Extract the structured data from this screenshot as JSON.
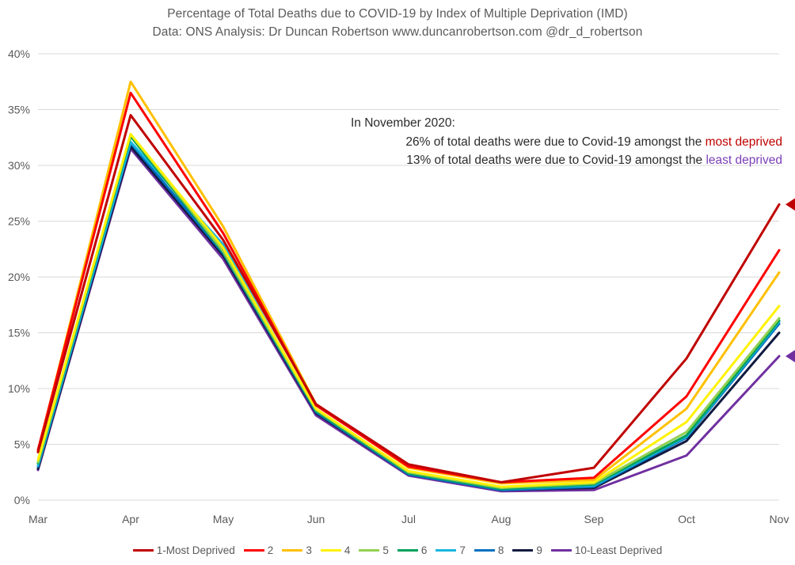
{
  "title": {
    "line1": "Percentage of Total Deaths due to COVID-19 by Index of Multiple Deprivation (IMD)",
    "line2": "Data: ONS Analysis: Dr Duncan Robertson www.duncanrobertson.com @dr_d_robertson"
  },
  "annotation": {
    "line1": "In November 2020:",
    "line2_prefix": "26% of total deaths were due to Covid-19 amongst the ",
    "line2_emphasis": "most deprived",
    "line3_prefix": "13% of total deaths were due to Covid-19 amongst the ",
    "line3_emphasis": "least deprived",
    "most_deprived_color": "#C00000",
    "least_deprived_color": "#7B3FB5"
  },
  "arrows": [
    {
      "name": "most-deprived-arrow",
      "color": "#C00000",
      "value": 26.5
    },
    {
      "name": "least-deprived-arrow",
      "color": "#7030A0",
      "value": 12.9
    }
  ],
  "legend": {
    "position": "bottom",
    "items": [
      {
        "label": "1-Most Deprived",
        "color": "#C00000"
      },
      {
        "label": "2",
        "color": "#FF0000"
      },
      {
        "label": "3",
        "color": "#FFC000"
      },
      {
        "label": "4",
        "color": "#FFF200"
      },
      {
        "label": "5",
        "color": "#92D050"
      },
      {
        "label": "6",
        "color": "#00A15C"
      },
      {
        "label": "7",
        "color": "#19B5DE"
      },
      {
        "label": "8",
        "color": "#0070C0"
      },
      {
        "label": "9",
        "color": "#111A40"
      },
      {
        "label": "10-Least Deprived",
        "color": "#7030A0"
      }
    ]
  },
  "chart_data": {
    "type": "line",
    "title": "Percentage of Total Deaths due to COVID-19 by Index of Multiple Deprivation (IMD)",
    "subtitle": "Data: ONS Analysis: Dr Duncan Robertson www.duncanrobertson.com @dr_d_robertson",
    "xlabel": "",
    "ylabel": "",
    "categories": [
      "Mar",
      "Apr",
      "May",
      "Jun",
      "Jul",
      "Aug",
      "Sep",
      "Oct",
      "Nov"
    ],
    "x_tick_labels": [
      "Mar",
      "Apr",
      "May",
      "Jun",
      "Jul",
      "Aug",
      "Sep",
      "Oct",
      "Nov"
    ],
    "y_tick_labels": [
      "0%",
      "5%",
      "10%",
      "15%",
      "20%",
      "25%",
      "30%",
      "35%",
      "40%"
    ],
    "y_ticks": [
      0,
      5,
      10,
      15,
      20,
      25,
      30,
      35,
      40
    ],
    "ylim": [
      0,
      40
    ],
    "grid": "horizontal",
    "units": "percent",
    "series": [
      {
        "name": "1-Most Deprived",
        "color": "#C00000",
        "values": [
          4.3,
          34.5,
          23.3,
          8.6,
          3.2,
          1.6,
          2.9,
          12.7,
          26.5
        ]
      },
      {
        "name": "2",
        "color": "#FF0000",
        "values": [
          4.5,
          36.5,
          23.9,
          8.5,
          3.0,
          1.6,
          2.0,
          9.3,
          22.4
        ]
      },
      {
        "name": "3",
        "color": "#FFC000",
        "values": [
          4.4,
          37.5,
          24.5,
          8.6,
          2.9,
          1.5,
          1.8,
          8.2,
          20.4
        ]
      },
      {
        "name": "4",
        "color": "#FFF200",
        "values": [
          3.6,
          32.8,
          22.6,
          8.2,
          2.6,
          1.2,
          1.6,
          7.0,
          17.4
        ]
      },
      {
        "name": "5",
        "color": "#92D050",
        "values": [
          3.4,
          32.8,
          22.3,
          8.1,
          2.5,
          1.1,
          1.5,
          6.1,
          16.3
        ]
      },
      {
        "name": "6",
        "color": "#00A15C",
        "values": [
          3.3,
          32.6,
          22.2,
          8.0,
          2.4,
          1.0,
          1.4,
          5.8,
          16.1
        ]
      },
      {
        "name": "7",
        "color": "#19B5DE",
        "values": [
          3.1,
          32.1,
          22.9,
          8.0,
          2.4,
          1.0,
          1.3,
          5.7,
          16.0
        ]
      },
      {
        "name": "8",
        "color": "#0070C0",
        "values": [
          3.0,
          32.0,
          22.1,
          7.9,
          2.3,
          0.9,
          1.2,
          5.6,
          15.8
        ]
      },
      {
        "name": "9",
        "color": "#111A40",
        "values": [
          2.8,
          31.7,
          21.9,
          7.8,
          2.3,
          0.9,
          1.1,
          5.3,
          15.0
        ]
      },
      {
        "name": "10-Least Deprived",
        "color": "#7030A0",
        "values": [
          2.7,
          31.5,
          21.6,
          7.6,
          2.2,
          0.8,
          0.9,
          4.0,
          12.9
        ]
      }
    ]
  }
}
